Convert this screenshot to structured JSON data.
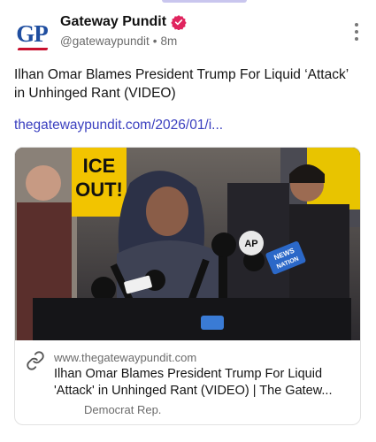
{
  "post": {
    "author": {
      "display_name": "Gateway Pundit",
      "handle": "@gatewaypundit",
      "separator": "•",
      "time": "8m",
      "avatar_text": "GP"
    },
    "text": "Ilhan Omar Blames President Trump For Liquid ‘Attack’ in Unhinged Rant (VIDEO)",
    "link_text": "thegatewaypundit.com/2026/01/i..."
  },
  "card": {
    "image_signs": {
      "ice_sign_line1": "ICE",
      "ice_sign_line2": "OUT!",
      "mic_ap": "AP",
      "mic_news": "NEWS",
      "mic_nation": "NATION"
    },
    "domain": "www.thegatewaypundit.com",
    "title": "Ilhan Omar Blames President Trump For Liquid 'Attack' in Unhinged Rant (VIDEO) | The Gatew...",
    "description": "Democrat Rep."
  },
  "colors": {
    "link": "#3a3fbf",
    "verified_badge": "#e0245e",
    "logo_blue": "#1f4ea0"
  }
}
